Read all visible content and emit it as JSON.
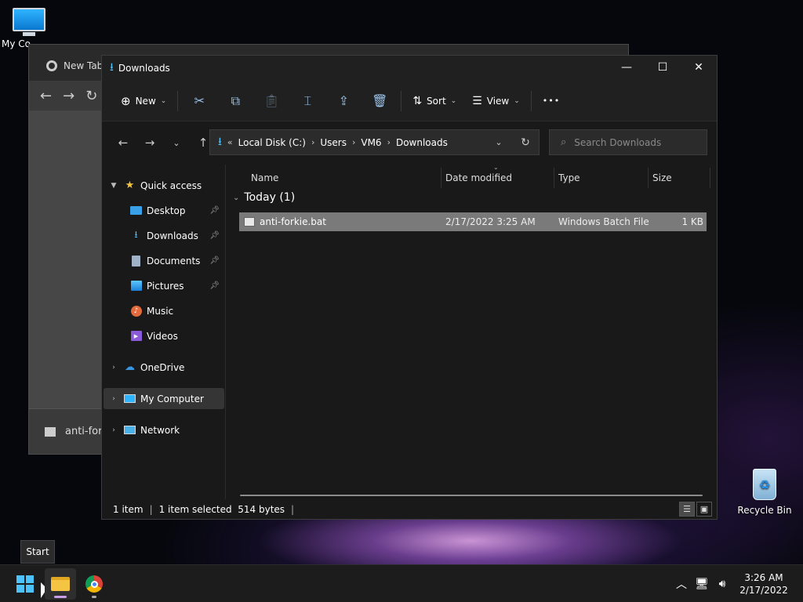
{
  "desktop": {
    "my_computer_label": "My Co",
    "recycle_bin_label": "Recycle Bin"
  },
  "chrome": {
    "tab_title": "New Tab",
    "download_name": "anti-for"
  },
  "explorer": {
    "title": "Downloads",
    "commands": {
      "new": "New",
      "sort": "Sort",
      "view": "View",
      "more": "•••"
    },
    "address": {
      "overflow": "«",
      "parts": [
        "Local Disk (C:)",
        "Users",
        "VM6",
        "Downloads"
      ]
    },
    "search_placeholder": "Search Downloads",
    "sidebar": {
      "quick_access": "Quick access",
      "items": [
        "Desktop",
        "Downloads",
        "Documents",
        "Pictures",
        "Music",
        "Videos"
      ],
      "onedrive": "OneDrive",
      "my_computer": "My Computer",
      "network": "Network"
    },
    "columns": {
      "name": "Name",
      "date": "Date modified",
      "type": "Type",
      "size": "Size"
    },
    "group": "Today (1)",
    "files": [
      {
        "name": "anti-forkie.bat",
        "date": "2/17/2022 3:25 AM",
        "type": "Windows Batch File",
        "size": "1 KB"
      }
    ],
    "status": {
      "count": "1 item",
      "selected": "1 item selected  514 bytes"
    }
  },
  "taskbar": {
    "tooltip": "Start",
    "time": "3:26 AM",
    "date": "2/17/2022"
  },
  "colors": {
    "accent": "#4cc2ff",
    "folder_yellow": "#f4c542",
    "selected_row": "#7a7a7a"
  }
}
